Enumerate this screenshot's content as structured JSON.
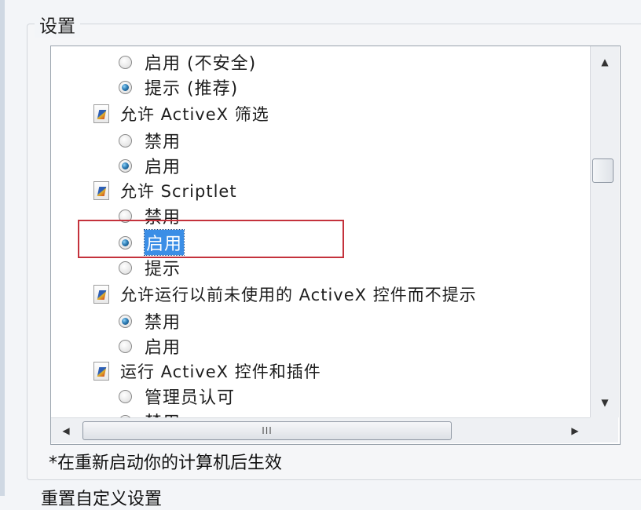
{
  "settings_group": {
    "title": "设置",
    "tree": {
      "items": [
        {
          "type": "radio",
          "label": "启用 (不安全)",
          "checked": false
        },
        {
          "type": "radio",
          "label": "提示 (推荐)",
          "checked": true
        },
        {
          "type": "category",
          "label": "允许 ActiveX 筛选",
          "icon": "settings-category-icon"
        },
        {
          "type": "radio",
          "label": "禁用",
          "checked": false
        },
        {
          "type": "radio",
          "label": "启用",
          "checked": true
        },
        {
          "type": "category",
          "label": "允许 Scriptlet",
          "icon": "settings-category-icon"
        },
        {
          "type": "radio",
          "label": "禁用",
          "checked": false
        },
        {
          "type": "radio",
          "label": "启用",
          "checked": true,
          "selected": true
        },
        {
          "type": "radio",
          "label": "提示",
          "checked": false
        },
        {
          "type": "category",
          "label": "允许运行以前未使用的 ActiveX 控件而不提示",
          "icon": "settings-category-icon"
        },
        {
          "type": "radio",
          "label": "禁用",
          "checked": true
        },
        {
          "type": "radio",
          "label": "启用",
          "checked": false
        },
        {
          "type": "category",
          "label": "运行 ActiveX 控件和插件",
          "icon": "settings-category-icon"
        },
        {
          "type": "radio",
          "label": "管理员认可",
          "checked": false
        },
        {
          "type": "radio",
          "label": "禁用",
          "checked": false
        }
      ]
    },
    "scrollbars": {
      "vertical": {
        "up_icon": "▲",
        "down_icon": "▼"
      },
      "horizontal": {
        "left_icon": "◀",
        "right_icon": "▶",
        "grip": "III"
      }
    },
    "note": "*在重新启动你的计算机后生效"
  },
  "bottom_label": "重置自定义设置",
  "colors": {
    "selection": "#3b8ee6",
    "highlight_box": "#c4323c",
    "radio_checked": "#2f7fb8"
  }
}
